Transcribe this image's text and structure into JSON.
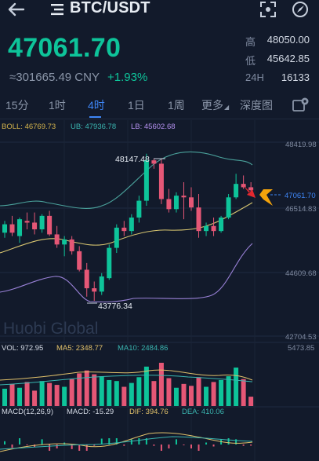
{
  "header": {
    "pair": "BTC/USDT"
  },
  "ticker": {
    "last_price": "47061.70",
    "cny_value": "≈301665.49 CNY",
    "change": "+1.93%",
    "stats": [
      {
        "label": "高",
        "value": "48050.00"
      },
      {
        "label": "低",
        "value": "45642.85"
      },
      {
        "label": "24H",
        "value": "16133"
      }
    ]
  },
  "tabs": [
    {
      "label": "15分"
    },
    {
      "label": "1时"
    },
    {
      "label": "4时",
      "active": true
    },
    {
      "label": "1日"
    },
    {
      "label": "1周"
    },
    {
      "label": "更多"
    },
    {
      "label": "深度图"
    }
  ],
  "colors": {
    "up": "#0ec49a",
    "down": "#e55776",
    "accent": "#3e86f6",
    "background": "#121a2b"
  },
  "icons": [
    "back-arrow-icon",
    "list-icon",
    "fullscreen-icon",
    "compass-icon",
    "settings-icon",
    "triangle-caret-icon"
  ],
  "watermark": "Huobi Global",
  "chart_data": {
    "type": "candlestick",
    "indicators": {
      "boll": "BOLL: 46769.73",
      "ub": "UB: 47936.78",
      "lb": "LB: 45602.68"
    },
    "y_axis_labels": [
      "48419.98",
      "47061.70",
      "46514.83",
      "44609.68",
      "42704.53"
    ],
    "ylim": [
      42704.53,
      48419.98
    ],
    "high_marker": "48147.48",
    "low_marker": "43776.34",
    "candles": [
      {
        "o": 45800,
        "h": 46150,
        "l": 45650,
        "c": 46050
      },
      {
        "o": 46050,
        "h": 46300,
        "l": 45700,
        "c": 45800
      },
      {
        "o": 45700,
        "h": 46250,
        "l": 45500,
        "c": 46200
      },
      {
        "o": 46150,
        "h": 46400,
        "l": 45900,
        "c": 46100
      },
      {
        "o": 46100,
        "h": 46400,
        "l": 45750,
        "c": 45900
      },
      {
        "o": 45900,
        "h": 46350,
        "l": 45800,
        "c": 46300
      },
      {
        "o": 46300,
        "h": 46450,
        "l": 45700,
        "c": 45750
      },
      {
        "o": 45750,
        "h": 46000,
        "l": 45350,
        "c": 45450
      },
      {
        "o": 45450,
        "h": 45700,
        "l": 45100,
        "c": 45600
      },
      {
        "o": 45600,
        "h": 45700,
        "l": 45150,
        "c": 45250
      },
      {
        "o": 45250,
        "h": 45400,
        "l": 44650,
        "c": 44700
      },
      {
        "o": 44700,
        "h": 44900,
        "l": 43900,
        "c": 44150
      },
      {
        "o": 44150,
        "h": 44350,
        "l": 43776.34,
        "c": 44050
      },
      {
        "o": 44050,
        "h": 44600,
        "l": 43950,
        "c": 44500
      },
      {
        "o": 44450,
        "h": 45450,
        "l": 44400,
        "c": 45350
      },
      {
        "o": 45350,
        "h": 46050,
        "l": 45200,
        "c": 45950
      },
      {
        "o": 45950,
        "h": 46150,
        "l": 45700,
        "c": 45850
      },
      {
        "o": 45850,
        "h": 46350,
        "l": 45750,
        "c": 46250
      },
      {
        "o": 46250,
        "h": 46900,
        "l": 46100,
        "c": 46750
      },
      {
        "o": 46750,
        "h": 48147.48,
        "l": 46600,
        "c": 47950
      },
      {
        "o": 47950,
        "h": 48000,
        "l": 47700,
        "c": 47850
      },
      {
        "o": 47850,
        "h": 48000,
        "l": 46650,
        "c": 46800
      },
      {
        "o": 46800,
        "h": 47100,
        "l": 46400,
        "c": 46500
      },
      {
        "o": 46500,
        "h": 47000,
        "l": 46400,
        "c": 46900
      },
      {
        "o": 46900,
        "h": 47300,
        "l": 46200,
        "c": 46850
      },
      {
        "o": 46850,
        "h": 47150,
        "l": 46450,
        "c": 46550
      },
      {
        "o": 46550,
        "h": 46950,
        "l": 45650,
        "c": 45850
      },
      {
        "o": 45850,
        "h": 46100,
        "l": 45700,
        "c": 46000
      },
      {
        "o": 46000,
        "h": 46250,
        "l": 45700,
        "c": 45850
      },
      {
        "o": 45850,
        "h": 46300,
        "l": 45800,
        "c": 46250
      },
      {
        "o": 46250,
        "h": 46950,
        "l": 46200,
        "c": 46850
      },
      {
        "o": 46850,
        "h": 47550,
        "l": 46800,
        "c": 47250
      },
      {
        "o": 47250,
        "h": 47500,
        "l": 47100,
        "c": 47150
      },
      {
        "o": 47150,
        "h": 47300,
        "l": 46950,
        "c": 47061.7
      }
    ],
    "volume_indicators": {
      "vol": "VOL: 972.95",
      "ma5": "MA5: 2348.77",
      "ma10": "MA10: 2484.86"
    },
    "volume_axis_label": "5473.85",
    "volumes": [
      1800,
      2300,
      1900,
      2500,
      1600,
      2600,
      2400,
      2200,
      2000,
      2800,
      3400,
      3700,
      3300,
      3100,
      2700,
      2600,
      2000,
      2400,
      3000,
      4100,
      2600,
      4500,
      2900,
      1900,
      2300,
      2100,
      3000,
      2000,
      2500,
      2700,
      3100,
      4000,
      2800,
      972.95
    ],
    "volume_ylim": [
      0,
      5473.85
    ],
    "macd_indicators": {
      "params": "MACD(12,26,9)",
      "macd": "MACD: -15.29",
      "dif": "DIF: 394.76",
      "dea": "DEA: 410.06"
    }
  }
}
